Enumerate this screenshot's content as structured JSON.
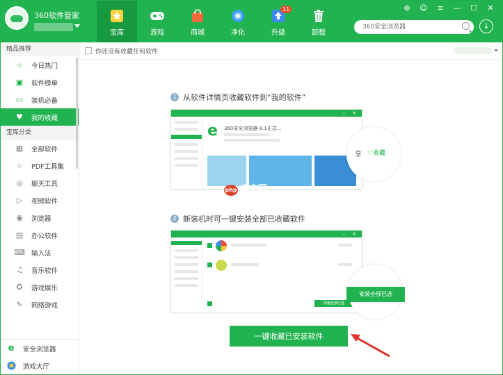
{
  "header": {
    "brand": "360软件管家",
    "nav": [
      {
        "label": "宝库",
        "icon": "star-icon"
      },
      {
        "label": "游戏",
        "icon": "gamepad-icon"
      },
      {
        "label": "商城",
        "icon": "bag-icon"
      },
      {
        "label": "净化",
        "icon": "purify-icon"
      },
      {
        "label": "升级",
        "icon": "upgrade-icon",
        "badge": "11"
      },
      {
        "label": "卸载",
        "icon": "trash-icon"
      }
    ],
    "search_placeholder": "360安全浏览器",
    "accent": "#21b34f"
  },
  "sidebar": {
    "section1": "精品推荐",
    "items1": [
      {
        "label": "今日热门",
        "icon": "star-outline-icon"
      },
      {
        "label": "软件榜单",
        "icon": "chart-icon"
      },
      {
        "label": "装机必备",
        "icon": "monitor-icon"
      },
      {
        "label": "我的收藏",
        "icon": "heart-icon",
        "active": true
      }
    ],
    "section2": "宝库分类",
    "items2": [
      {
        "label": "全部软件",
        "icon": "grid-icon"
      },
      {
        "label": "PDF工具集",
        "icon": "star-outline-icon"
      },
      {
        "label": "聊天工具",
        "icon": "chat-icon"
      },
      {
        "label": "视频软件",
        "icon": "video-icon"
      },
      {
        "label": "浏览器",
        "icon": "browser-icon"
      },
      {
        "label": "办公软件",
        "icon": "office-icon"
      },
      {
        "label": "输入法",
        "icon": "keyboard-icon"
      },
      {
        "label": "音乐软件",
        "icon": "music-icon"
      },
      {
        "label": "游戏娱乐",
        "icon": "game-icon"
      },
      {
        "label": "网络游戏",
        "icon": "network-icon"
      }
    ],
    "bottom": [
      {
        "label": "安全浏览器",
        "icon": "ie-icon"
      },
      {
        "label": "游戏大厅",
        "icon": "game-hall-icon"
      }
    ]
  },
  "main": {
    "topbar_text": "你还没有收藏任何软件",
    "step1": {
      "num": "1",
      "text": "从软件详情页收藏软件到“我的软件”"
    },
    "step2": {
      "num": "2",
      "text": "新装机时可一键安装全部已收藏软件"
    },
    "mock1": {
      "item_title": "360安全浏览器 8.1正式...",
      "share": "享",
      "fav": "收藏"
    },
    "mock2": {
      "install_all": "安装全部已选",
      "install_all_small": "安装全部已选"
    },
    "cta": "一键收藏已安装软件",
    "watermark": "中文网"
  }
}
